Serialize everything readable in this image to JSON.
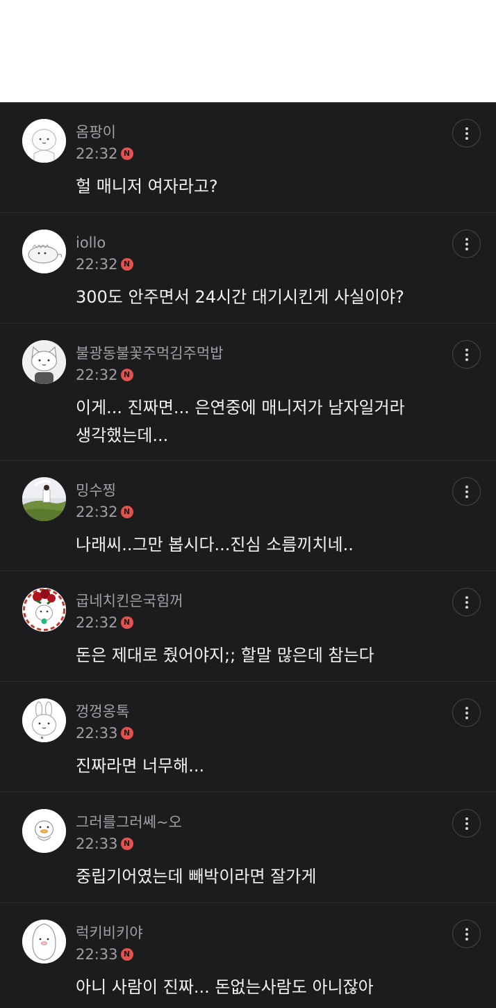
{
  "badge_label": "N",
  "comments": [
    {
      "nickname": "옴팡이",
      "time": "22:32",
      "text": "헐 매니저 여자라고?",
      "avatar_icon": "cute-character-avatar-icon"
    },
    {
      "nickname": "iollo",
      "time": "22:32",
      "text": "300도 안주면서 24시간 대기시킨게 사실이야?",
      "avatar_icon": "dinosaur-character-avatar-icon"
    },
    {
      "nickname": "불광동불꽃주먹김주먹밥",
      "time": "22:32",
      "text": "이게... 진짜면... 은연중에 매니저가 남자일거라\n생각했는데...",
      "avatar_icon": "cat-character-avatar-icon"
    },
    {
      "nickname": "밍수찡",
      "time": "22:32",
      "text": "나래씨..그만 봅시다...진심 소름끼치네..",
      "avatar_icon": "photo-avatar-icon"
    },
    {
      "nickname": "굽네치킨은국힘꺼",
      "time": "22:32",
      "text": "돈은 제대로 줬어야지;; 할말 많은데 참는다",
      "avatar_icon": "flower-character-avatar-icon"
    },
    {
      "nickname": "껑껑옹톡",
      "time": "22:33",
      "text": "진짜라면 너무해...",
      "avatar_icon": "rabbit-character-avatar-icon"
    },
    {
      "nickname": "그러를그러쎄~오",
      "time": "22:33",
      "text": "중립기어였는데 빼박이라면 잘가게",
      "avatar_icon": "duck-character-avatar-icon"
    },
    {
      "nickname": "럭키비키야",
      "time": "22:33",
      "text": "아니 사람이 진짜... 돈없는사람도 아니잖아",
      "avatar_icon": "penguin-character-avatar-icon"
    }
  ]
}
